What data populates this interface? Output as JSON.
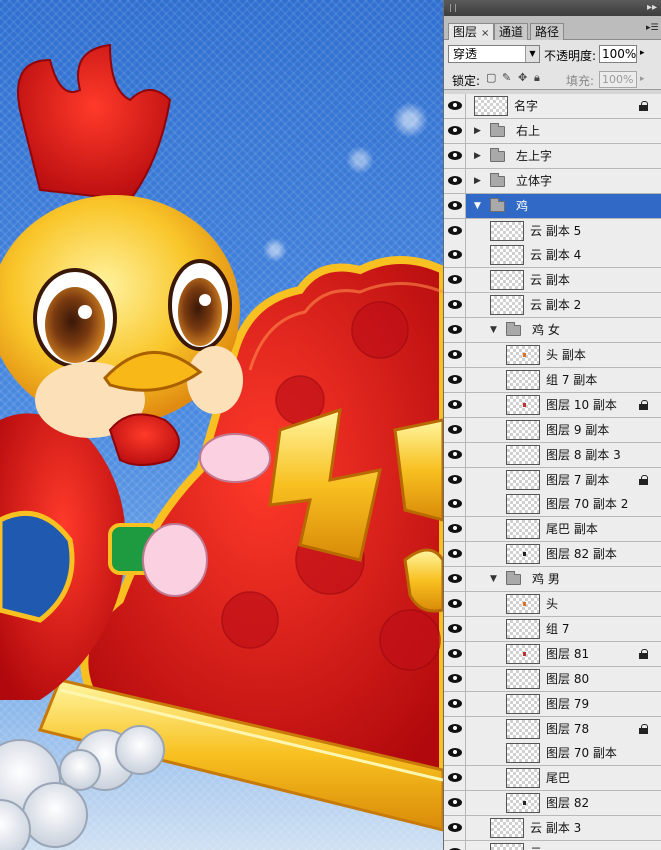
{
  "panel": {
    "tabs": [
      {
        "label": "图层",
        "close": "×"
      },
      {
        "label": "通道"
      },
      {
        "label": "路径"
      }
    ],
    "menu_icon": "panel-menu-icon",
    "collapse_icon": "▸▸",
    "blend_mode": "穿透",
    "opacity_label": "不透明度:",
    "opacity_value": "100%",
    "lock_label": "锁定:",
    "fill_label": "填充:",
    "fill_value": "100%"
  },
  "layers": [
    {
      "name": "名字",
      "type": "layer",
      "indent": 0,
      "locked": true,
      "selected": false,
      "visible": true
    },
    {
      "name": "右上",
      "type": "group",
      "indent": 0,
      "expanded": false,
      "visible": true
    },
    {
      "name": "左上字",
      "type": "group",
      "indent": 0,
      "expanded": false,
      "visible": true
    },
    {
      "name": "立体字",
      "type": "group",
      "indent": 0,
      "expanded": false,
      "visible": true
    },
    {
      "name": "鸡",
      "type": "group",
      "indent": 0,
      "expanded": true,
      "selected": true,
      "visible": true
    },
    {
      "name": "云 副本 5",
      "type": "layer",
      "indent": 1,
      "visible": true
    },
    {
      "name": "云 副本 4",
      "type": "layer",
      "indent": 1,
      "visible": true
    },
    {
      "name": "云 副本",
      "type": "layer",
      "indent": 1,
      "visible": true
    },
    {
      "name": "云 副本 2",
      "type": "layer",
      "indent": 1,
      "visible": true
    },
    {
      "name": "鸡 女",
      "type": "group",
      "indent": 1,
      "expanded": true,
      "visible": true
    },
    {
      "name": "头 副本",
      "type": "layer",
      "indent": 2,
      "visible": true,
      "mark": "#e07020"
    },
    {
      "name": "组 7 副本",
      "type": "layer",
      "indent": 2,
      "visible": true
    },
    {
      "name": "图层 10 副本",
      "type": "layer",
      "indent": 2,
      "locked": true,
      "visible": true,
      "mark": "#c03030"
    },
    {
      "name": "图层 9 副本",
      "type": "layer",
      "indent": 2,
      "visible": true
    },
    {
      "name": "图层 8 副本 3",
      "type": "layer",
      "indent": 2,
      "visible": true
    },
    {
      "name": "图层 7 副本",
      "type": "layer",
      "indent": 2,
      "locked": true,
      "visible": true
    },
    {
      "name": "图层 70 副本 2",
      "type": "layer",
      "indent": 2,
      "visible": true
    },
    {
      "name": "尾巴 副本",
      "type": "layer",
      "indent": 2,
      "visible": true
    },
    {
      "name": "图层 82 副本",
      "type": "layer",
      "indent": 2,
      "visible": true,
      "mark": "#222222"
    },
    {
      "name": "鸡 男",
      "type": "group",
      "indent": 1,
      "expanded": true,
      "visible": true
    },
    {
      "name": "头",
      "type": "layer",
      "indent": 2,
      "visible": true,
      "mark": "#e07020"
    },
    {
      "name": "组 7",
      "type": "layer",
      "indent": 2,
      "visible": true
    },
    {
      "name": "图层 81",
      "type": "layer",
      "indent": 2,
      "locked": true,
      "visible": true,
      "mark": "#c03030"
    },
    {
      "name": "图层 80",
      "type": "layer",
      "indent": 2,
      "visible": true
    },
    {
      "name": "图层 79",
      "type": "layer",
      "indent": 2,
      "visible": true
    },
    {
      "name": "图层 78",
      "type": "layer",
      "indent": 2,
      "locked": true,
      "visible": true
    },
    {
      "name": "图层 70 副本",
      "type": "layer",
      "indent": 2,
      "visible": true
    },
    {
      "name": "尾巴",
      "type": "layer",
      "indent": 2,
      "visible": true
    },
    {
      "name": "图层 82",
      "type": "layer",
      "indent": 2,
      "visible": true,
      "mark": "#222222"
    },
    {
      "name": "云 副本 3",
      "type": "layer",
      "indent": 1,
      "visible": true
    },
    {
      "name": "云",
      "type": "layer",
      "indent": 1,
      "visible": true
    }
  ],
  "colors": {
    "selection": "#3169c6",
    "panel_bg": "#d6d6d6",
    "row_bg": "#ededed",
    "canvas_sky": "#3b78c8",
    "artwork_red": "#d8141c",
    "artwork_gold": "#f8c020"
  }
}
